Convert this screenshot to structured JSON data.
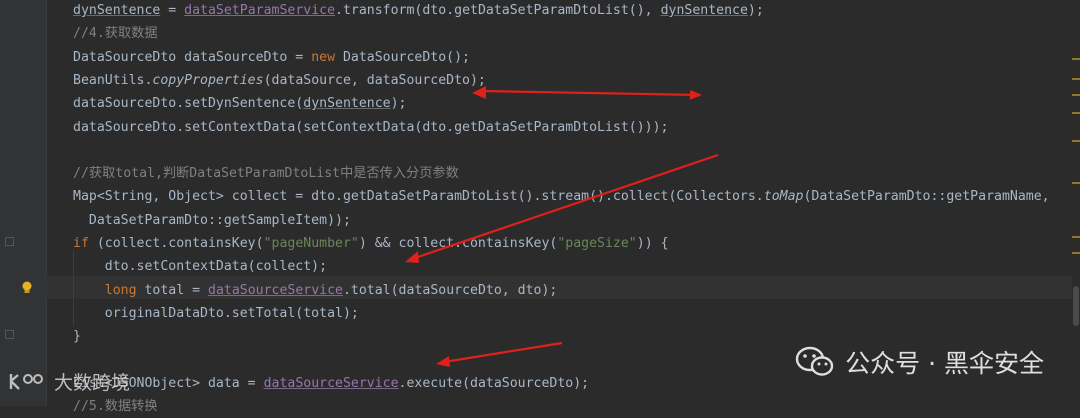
{
  "editor": {
    "lines": [
      {
        "segs": [
          {
            "t": "dynSentence",
            "c": "und"
          },
          {
            "t": " = "
          },
          {
            "t": "dataSetParamService",
            "c": "svc"
          },
          {
            "t": ".transform(dto.getDataSetParamDtoList(), "
          },
          {
            "t": "dynSentence",
            "c": "und"
          },
          {
            "t": ");"
          }
        ]
      },
      {
        "segs": [
          {
            "t": "//4.获取数据",
            "c": "cmt"
          }
        ]
      },
      {
        "segs": [
          {
            "t": "DataSourceDto dataSourceDto = "
          },
          {
            "t": "new",
            "c": "kw"
          },
          {
            "t": " DataSourceDto();"
          }
        ]
      },
      {
        "segs": [
          {
            "t": "BeanUtils."
          },
          {
            "t": "copyProperties",
            "c": "ital"
          },
          {
            "t": "(dataSource, dataSourceDto);"
          }
        ]
      },
      {
        "segs": [
          {
            "t": "dataSourceDto.setDynSentence("
          },
          {
            "t": "dynSentence",
            "c": "und"
          },
          {
            "t": ");"
          }
        ]
      },
      {
        "segs": [
          {
            "t": "dataSourceDto.setContextData(setContextData(dto.getDataSetParamDtoList()));"
          }
        ]
      },
      {
        "segs": []
      },
      {
        "segs": [
          {
            "t": "//获取total,判断DataSetParamDtoList中是否传入分页参数",
            "c": "cmt"
          }
        ]
      },
      {
        "segs": [
          {
            "t": "Map<String, Object> collect = dto.getDataSetParamDtoList().stream().collect(Collectors."
          },
          {
            "t": "toMap",
            "c": "ital"
          },
          {
            "t": "(DataSetParamDto::getParamName,"
          }
        ]
      },
      {
        "segs": [
          {
            "t": "  DataSetParamDto::getSampleItem));"
          }
        ]
      },
      {
        "segs": [
          {
            "t": "if",
            "c": "kw"
          },
          {
            "t": " (collect.containsKey("
          },
          {
            "t": "\"pageNumber\"",
            "c": "str"
          },
          {
            "t": ") && collect.containsKey("
          },
          {
            "t": "\"pageSize\"",
            "c": "str"
          },
          {
            "t": ")) {"
          }
        ]
      },
      {
        "segs": [
          {
            "t": "    dto.setContextData(collect);"
          }
        ]
      },
      {
        "segs": [
          {
            "t": "    "
          },
          {
            "t": "long",
            "c": "kw"
          },
          {
            "t": " total = "
          },
          {
            "t": "dataSourceService",
            "c": "svc"
          },
          {
            "t": ".total(dataSourceDto, dto);"
          }
        ]
      },
      {
        "segs": [
          {
            "t": "    originalDataDto.setTotal(total);"
          }
        ]
      },
      {
        "segs": [
          {
            "t": "}"
          }
        ]
      },
      {
        "segs": []
      },
      {
        "segs": [
          {
            "t": "List<JSONObject> data = "
          },
          {
            "t": "dataSourceService",
            "c": "svc"
          },
          {
            "t": ".execute(dataSourceDto);"
          }
        ]
      },
      {
        "segs": [
          {
            "t": "//5.数据转换",
            "c": "cmt"
          }
        ]
      }
    ]
  },
  "watermark": {
    "channel_label": "公众号 · 黑伞安全",
    "left_label": "大数跨境",
    "icon": "wechat-icon"
  },
  "annotations": {
    "arrow_color": "#e0201b",
    "count": 3
  }
}
